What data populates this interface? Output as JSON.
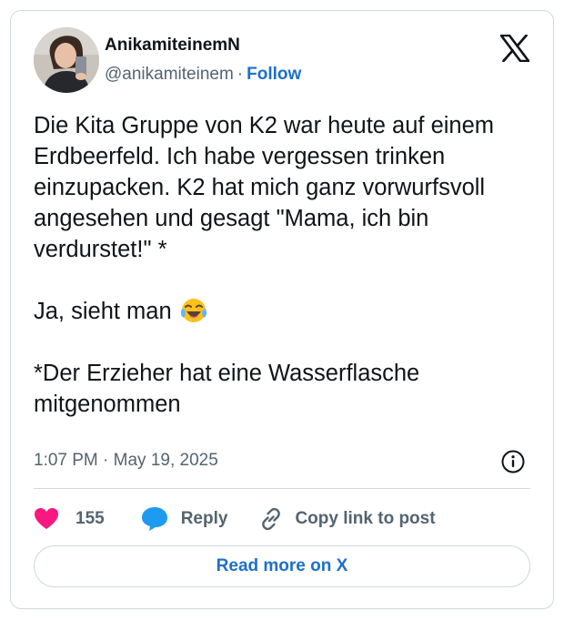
{
  "author": {
    "display_name": "AnikamiteinemN",
    "handle": "@anikamiteinem",
    "separator": "·",
    "follow_label": "Follow",
    "avatar_icon": "profile-photo"
  },
  "brand": {
    "logo_icon": "x-logo-icon"
  },
  "tweet": {
    "lines": [
      "Die Kita Gruppe von K2 war heute auf einem Erdbeerfeld. Ich habe vergessen trinken einzupacken. K2 hat mich ganz vorwurfsvoll angesehen und gesagt \"Mama, ich bin verdurstet!\" *",
      "Ja, sieht man",
      "*Der Erzieher hat eine Wasserflasche mitgenommen"
    ],
    "emoji_icon": "face-with-tears-of-joy-emoji"
  },
  "meta": {
    "timestamp": "1:07 PM · May 19, 2025",
    "info_icon": "info-icon"
  },
  "actions": {
    "like_count": "155",
    "reply_label": "Reply",
    "copy_label": "Copy link to post"
  },
  "footer": {
    "read_more_label": "Read more on X"
  },
  "colors": {
    "like": "#f91880",
    "reply": "#1d9bf0",
    "link": "#1d6fc9",
    "muted": "#536471",
    "border": "#cfd9de",
    "text": "#0f1419"
  }
}
